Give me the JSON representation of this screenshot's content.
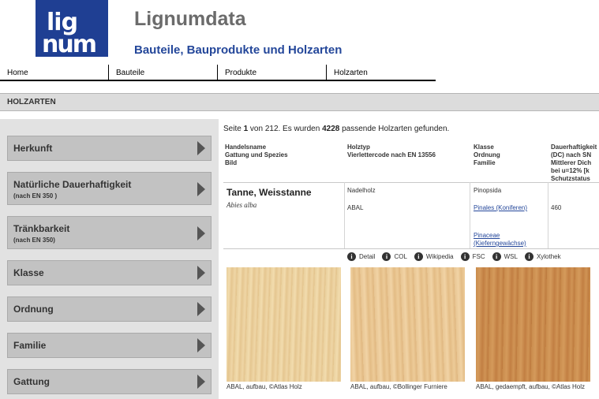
{
  "header": {
    "logo_top": "lig",
    "logo_bottom": "num",
    "title": "Lignumdata",
    "subtitle": "Bauteile, Bauprodukte und Holzarten"
  },
  "nav": [
    "Home",
    "Bauteile",
    "Produkte",
    "Holzarten"
  ],
  "section": {
    "title": "HOLZARTEN"
  },
  "sidebar": {
    "filters": [
      {
        "label": "Herkunft",
        "sub": ""
      },
      {
        "label": "Natürliche Dauerhaftigkeit",
        "sub": "(nach EN 350 )"
      },
      {
        "label": "Tränkbarkeit",
        "sub": "(nach EN 350)"
      },
      {
        "label": "Klasse",
        "sub": ""
      },
      {
        "label": "Ordnung",
        "sub": ""
      },
      {
        "label": "Familie",
        "sub": ""
      },
      {
        "label": "Gattung",
        "sub": ""
      }
    ]
  },
  "results": {
    "prefix": "Seite ",
    "page": "1",
    "middle": " von 212. Es wurden ",
    "count": "4228",
    "suffix": " passende Holzarten gefunden."
  },
  "columns": [
    {
      "lines": [
        "Handelsname",
        "Gattung und Spezies",
        "Bild"
      ]
    },
    {
      "lines": [
        "Holztyp",
        "Vierlettercode nach EN 13556"
      ]
    },
    {
      "lines": [
        "Klasse",
        "Ordnung",
        "Familie"
      ]
    },
    {
      "lines": [
        "Dauerhaftigkeit",
        "(DC) nach SN",
        "Mittlerer Dich",
        "bei u=12% [k",
        "Schutzstatus"
      ]
    }
  ],
  "entry": {
    "trade_name": "Tanne, Weisstanne",
    "species": "Abies alba",
    "holztyp": "Nadelholz",
    "code": "ABAL",
    "klasse": "Pinopsida",
    "ordnung": "Pinales (Koniferen)",
    "familie_line1": "Pinaceae",
    "familie_line2": "(Kieferngewächse)",
    "density": "460"
  },
  "links": [
    "Detail",
    "COL",
    "Wikipedia",
    "FSC",
    "WSL",
    "Xylothek"
  ],
  "images": [
    {
      "caption": "ABAL, aufbau, ©Atlas Holz"
    },
    {
      "caption": "ABAL, aufbau, ©Bollinger Furniere"
    },
    {
      "caption": "ABAL, gedaempft, aufbau, ©Atlas Holz"
    }
  ]
}
